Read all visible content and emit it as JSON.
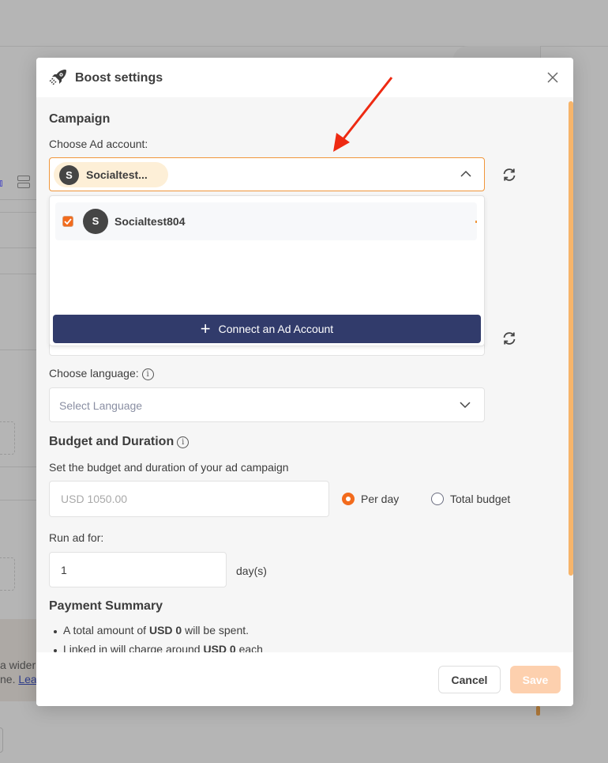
{
  "background": {
    "banner_text_line1": "a wider",
    "banner_text_line2_prefix": "ne. ",
    "banner_link": "Lea"
  },
  "modal": {
    "title": "Boost settings",
    "title_icon": "rocket-icon",
    "close_icon": "close-icon"
  },
  "campaign": {
    "section_title": "Campaign",
    "ad_account_label": "Choose Ad account:",
    "selected_chip": {
      "avatar_letter": "S",
      "label": "Socialtest..."
    },
    "dropdown_open": true,
    "options": [
      {
        "avatar_letter": "S",
        "name": "Socialtest804",
        "checked": true
      }
    ],
    "connect_button_label": "Connect an Ad Account",
    "refresh_icon": "refresh-icon"
  },
  "language": {
    "label": "Choose language:",
    "placeholder": "Select Language"
  },
  "budget": {
    "section_title": "Budget and Duration",
    "description": "Set the budget and duration of your ad campaign",
    "amount_placeholder": "USD 1050.00",
    "options": [
      {
        "label": "Per day",
        "selected": true
      },
      {
        "label": "Total budget",
        "selected": false
      }
    ],
    "run_label": "Run ad for:",
    "days_value": "1",
    "days_unit": "day(s)"
  },
  "payment": {
    "section_title": "Payment Summary",
    "line1_prefix": "A total amount of ",
    "line1_bold": "USD 0",
    "line1_suffix": " will be spent.",
    "line2_prefix": "Linked in will charge around ",
    "line2_bold": "USD 0",
    "line2_suffix": " each"
  },
  "footer": {
    "cancel_label": "Cancel",
    "save_label": "Save"
  },
  "colors": {
    "accent_orange": "#f26b1d",
    "focus_border": "#f0963a",
    "connect_button": "#313b6b",
    "save_disabled": "#fdd0ae",
    "chip_bg": "#fdefd7",
    "scrollbar": "#f6b46a",
    "annotation_arrow": "#ee2a12"
  }
}
